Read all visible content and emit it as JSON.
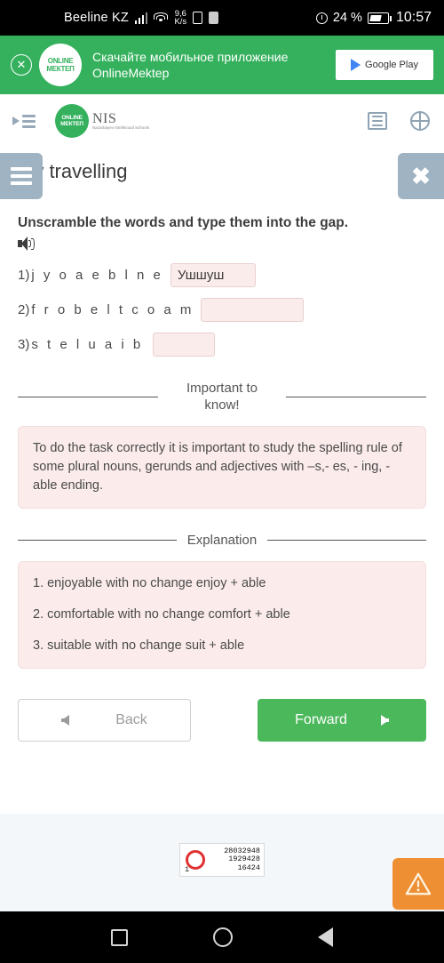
{
  "statusbar": {
    "carrier": "Beeline KZ",
    "network_speed": "9,6\nK/s",
    "speed_value": "9,6",
    "speed_unit": "K/s",
    "battery_percent": "24 %",
    "clock": "10:57",
    "icons": [
      "signal-icon",
      "wifi-icon",
      "sim-icon",
      "sd-icon",
      "alarm-icon",
      "battery-icon"
    ]
  },
  "promo": {
    "close_label": "✕",
    "logo_line1": "ONLINE",
    "logo_line2": "МЕКТЕП",
    "text": "Скачайте мобильное приложение OnlineMektep",
    "store_button": "Google Play"
  },
  "appbar": {
    "menu_icon": "indent-menu-icon",
    "brand_logo_line1": "ONLINE",
    "brand_logo_line2": "МЕКТЕП",
    "nis_name": "NIS",
    "nis_sub": "Nazarbayev Intellectual Schools",
    "list_icon": "list-icon",
    "language_icon": "globe-icon"
  },
  "sidetabs": {
    "left_label": "☰",
    "right_label": "✖"
  },
  "lesson": {
    "title": "My travelling",
    "task_instruction": "Unscramble the words and type them into the gap.",
    "audio_icon": "speaker-icon"
  },
  "questions": [
    {
      "num": "1)",
      "scrambled": "j y o a e b l n e",
      "answer": "Ушшуш",
      "placeholder": ""
    },
    {
      "num": "2)",
      "scrambled": "f r o b e l t c o a m",
      "answer": "",
      "placeholder": ""
    },
    {
      "num": "3)",
      "scrambled": "s t e l u a i b",
      "answer": "",
      "placeholder": ""
    }
  ],
  "important": {
    "heading": "Important to know!",
    "body": "To do the task correctly it is important to study the spelling rule of some plural nouns, gerunds and adjectives with –s,- es, - ing, -able ending."
  },
  "explanation": {
    "heading": "Explanation",
    "items": [
      "1. enjoyable with no change enjoy + able",
      "2. comfortable with no change comfort + able",
      "3. suitable with no change suit + able"
    ]
  },
  "navigation": {
    "back_label": "Back",
    "forward_label": "Forward"
  },
  "footer": {
    "counter_total": "28032948",
    "counter_second": "1929428",
    "counter_third": "16424",
    "counter_left": "1",
    "warning_icon": "warning-triangle-icon"
  },
  "androidnav": {
    "recents": "recents-square-icon",
    "home": "home-circle-icon",
    "back": "back-triangle-icon"
  },
  "colors": {
    "promo_green": "#35b15e",
    "forward_green": "#4cb85c",
    "pink_panel": "#fbeceb",
    "tab_blue_grey": "#9fb3c2",
    "warn_orange": "#ef8f33"
  }
}
